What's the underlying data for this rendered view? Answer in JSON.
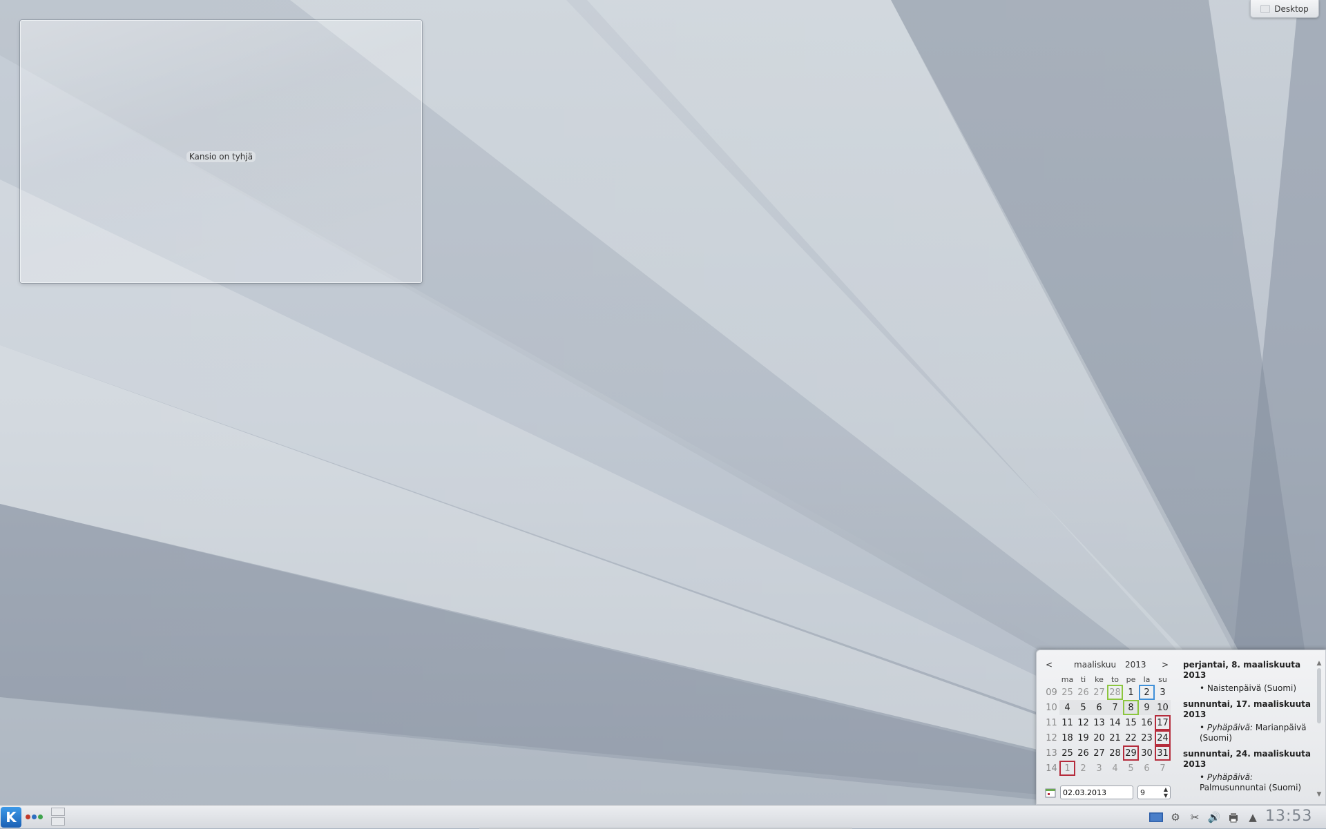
{
  "desktop": {
    "toolbox_label": "Desktop"
  },
  "folder_view": {
    "empty_text": "Kansio on tyhjä"
  },
  "calendar": {
    "prev": "<",
    "next": ">",
    "month": "maaliskuu",
    "year": "2013",
    "weekday_headers": [
      "ma",
      "ti",
      "ke",
      "to",
      "pe",
      "la",
      "su"
    ],
    "weeks": [
      {
        "week": "09",
        "days": [
          "25",
          "26",
          "27",
          "28",
          "1",
          "2",
          "3"
        ]
      },
      {
        "week": "10",
        "days": [
          "4",
          "5",
          "6",
          "7",
          "8",
          "9",
          "10"
        ]
      },
      {
        "week": "11",
        "days": [
          "11",
          "12",
          "13",
          "14",
          "15",
          "16",
          "17"
        ]
      },
      {
        "week": "12",
        "days": [
          "18",
          "19",
          "20",
          "21",
          "22",
          "23",
          "24"
        ]
      },
      {
        "week": "13",
        "days": [
          "25",
          "26",
          "27",
          "28",
          "29",
          "30",
          "31"
        ]
      },
      {
        "week": "14",
        "days": [
          "1",
          "2",
          "3",
          "4",
          "5",
          "6",
          "7"
        ]
      }
    ],
    "date_input": "02.03.2013",
    "week_spin": "9",
    "events": [
      {
        "date": "perjantai, 8. maaliskuuta 2013",
        "items": [
          {
            "prefix": "",
            "text": "Naistenpäivä (Suomi)"
          }
        ]
      },
      {
        "date": "sunnuntai, 17. maaliskuuta 2013",
        "items": [
          {
            "prefix": "Pyhäpäivä:",
            "text": "Marianpäivä (Suomi)"
          }
        ]
      },
      {
        "date": "sunnuntai, 24. maaliskuuta 2013",
        "items": [
          {
            "prefix": "Pyhäpäivä:",
            "text": "Palmusunnuntai (Suomi)"
          }
        ]
      }
    ]
  },
  "taskbar": {
    "kickoff_label": "K",
    "clock": "13:53",
    "tray_icons": [
      "display-icon",
      "settings-icon",
      "scissors-icon",
      "volume-icon",
      "printer-icon",
      "expand-up-icon"
    ]
  },
  "colors": {
    "accent_blue": "#3f8fd8",
    "holiday_red": "#b52c3c",
    "event_green": "#8cc63f"
  }
}
